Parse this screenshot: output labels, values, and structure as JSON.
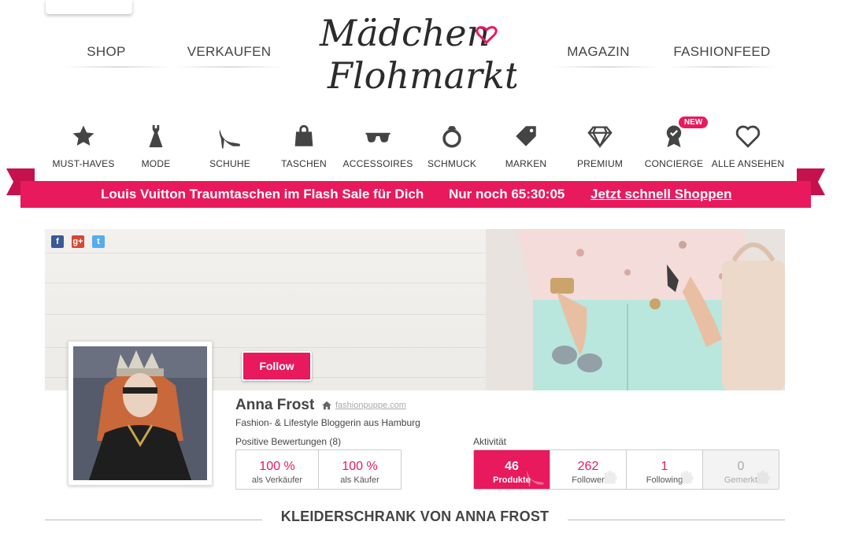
{
  "header": {
    "nav_left": [
      {
        "label": "SHOP"
      },
      {
        "label": "VERKAUFEN"
      }
    ],
    "nav_right": [
      {
        "label": "MAGAZIN"
      },
      {
        "label": "FASHIONFEED"
      }
    ],
    "logo_line1": "Mädchen",
    "logo_line2": "Flohmarkt",
    "accent_color": "#e8195d"
  },
  "categories": [
    {
      "label": "MUST-HAVES",
      "icon": "star-icon"
    },
    {
      "label": "MODE",
      "icon": "dress-icon"
    },
    {
      "label": "SCHUHE",
      "icon": "high-heel-icon"
    },
    {
      "label": "TASCHEN",
      "icon": "handbag-icon"
    },
    {
      "label": "ACCESSOIRES",
      "icon": "sunglasses-icon"
    },
    {
      "label": "SCHMUCK",
      "icon": "ring-icon"
    },
    {
      "label": "MARKEN",
      "icon": "tag-icon"
    },
    {
      "label": "PREMIUM",
      "icon": "diamond-icon"
    },
    {
      "label": "CONCIERGE",
      "icon": "award-icon"
    },
    {
      "label": "ALLE ANSEHEN",
      "icon": "heart-icon"
    }
  ],
  "new_badge": "NEW",
  "banner": {
    "text": "Louis Vuitton Traumtaschen im Flash Sale für Dich",
    "countdown": "Nur noch 65:30:05",
    "link": "Jetzt schnell Shoppen"
  },
  "social": {
    "facebook": "f",
    "googleplus": "g+",
    "twitter": "t"
  },
  "profile": {
    "follow_label": "Follow",
    "name": "Anna Frost",
    "website": "fashionpuppe.com",
    "bio": "Fashion- & Lifestyle Bloggerin aus Hamburg",
    "reviews_label": "Positive Bewertungen (8)",
    "reviews": [
      {
        "value": "100 %",
        "label": "als Verkäufer"
      },
      {
        "value": "100 %",
        "label": "als Käufer"
      }
    ],
    "activity_label": "Aktivität",
    "activity": [
      {
        "value": "46",
        "label": "Produkte"
      },
      {
        "value": "262",
        "label": "Follower"
      },
      {
        "value": "1",
        "label": "Following"
      },
      {
        "value": "0",
        "label": "Gemerkt"
      }
    ]
  },
  "section_title": "KLEIDERSCHRANK VON ANNA FROST"
}
